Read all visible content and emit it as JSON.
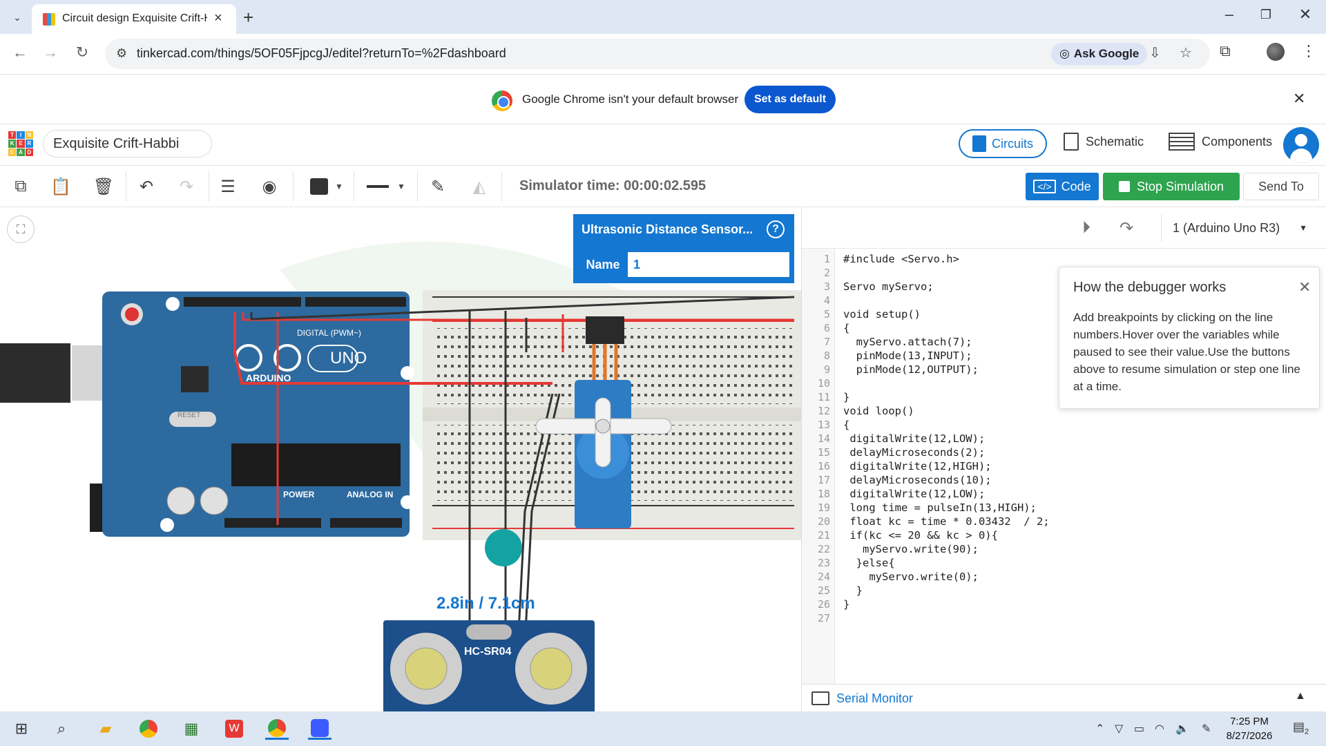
{
  "browser": {
    "tab_title": "Circuit design Exquisite Crift-Habbi",
    "new_tab": "+",
    "url": "tinkercad.com/things/5OF05FjpcgJ/editel?returnTo=%2Fdashboard",
    "ask_google": "Ask Google"
  },
  "banner": {
    "text": "Google Chrome isn't your default browser",
    "button": "Set as default"
  },
  "tinkercad": {
    "design_name": "Exquisite Crift-Habbi",
    "view_tabs": {
      "circuits": "Circuits",
      "schematic": "Schematic",
      "components": "Components"
    },
    "simulator_time": "Simulator time: 00:00:02.595",
    "code_button": "Code",
    "stop_button": "Stop Simulation",
    "send_button": "Send To"
  },
  "properties": {
    "title": "Ultrasonic Distance Sensor...",
    "help": "?",
    "name_label": "Name",
    "name_value": "1"
  },
  "canvas": {
    "distance_readout": "2.8in / 7.1cm",
    "sensor_model": "HC-SR04",
    "board_label": "UNO",
    "board_brand": "ARDUINO",
    "digital_label": "DIGITAL (PWM~)",
    "power_label": "POWER",
    "analog_label": "ANALOG IN",
    "reset_label": "RESET"
  },
  "code_panel": {
    "device": "1 (Arduino Uno R3)",
    "lines": [
      "#include <Servo.h>",
      "",
      "Servo myServo;",
      "",
      "void setup()",
      "{",
      "  myServo.attach(7);",
      "  pinMode(13,INPUT);",
      "  pinMode(12,OUTPUT);",
      "",
      "}",
      "void loop()",
      "{",
      " digitalWrite(12,LOW);",
      " delayMicroseconds(2);",
      " digitalWrite(12,HIGH);",
      " delayMicroseconds(10);",
      " digitalWrite(12,LOW);",
      " long time = pulseIn(13,HIGH);",
      " float kc = time * 0.03432  / 2;",
      " if(kc <= 20 && kc > 0){",
      "   myServo.write(90);",
      "  }else{",
      "    myServo.write(0);",
      "  }",
      "}",
      ""
    ],
    "debug_tip": {
      "title": "How the debugger works",
      "body": "Add breakpoints by clicking on the line numbers.Hover over the variables while paused to see their value.Use the buttons above to resume simulation or step one line at a time."
    },
    "serial_monitor": "Serial Monitor"
  },
  "taskbar": {
    "time": "7:25 PM",
    "date": "8/27/2026",
    "notification_count": "2"
  },
  "colors": {
    "accent": "#1477d1",
    "stop": "#2ea44f",
    "board": "#2d6a9f",
    "breadboard": "#e9e9e3",
    "wire_red": "#e53935"
  }
}
